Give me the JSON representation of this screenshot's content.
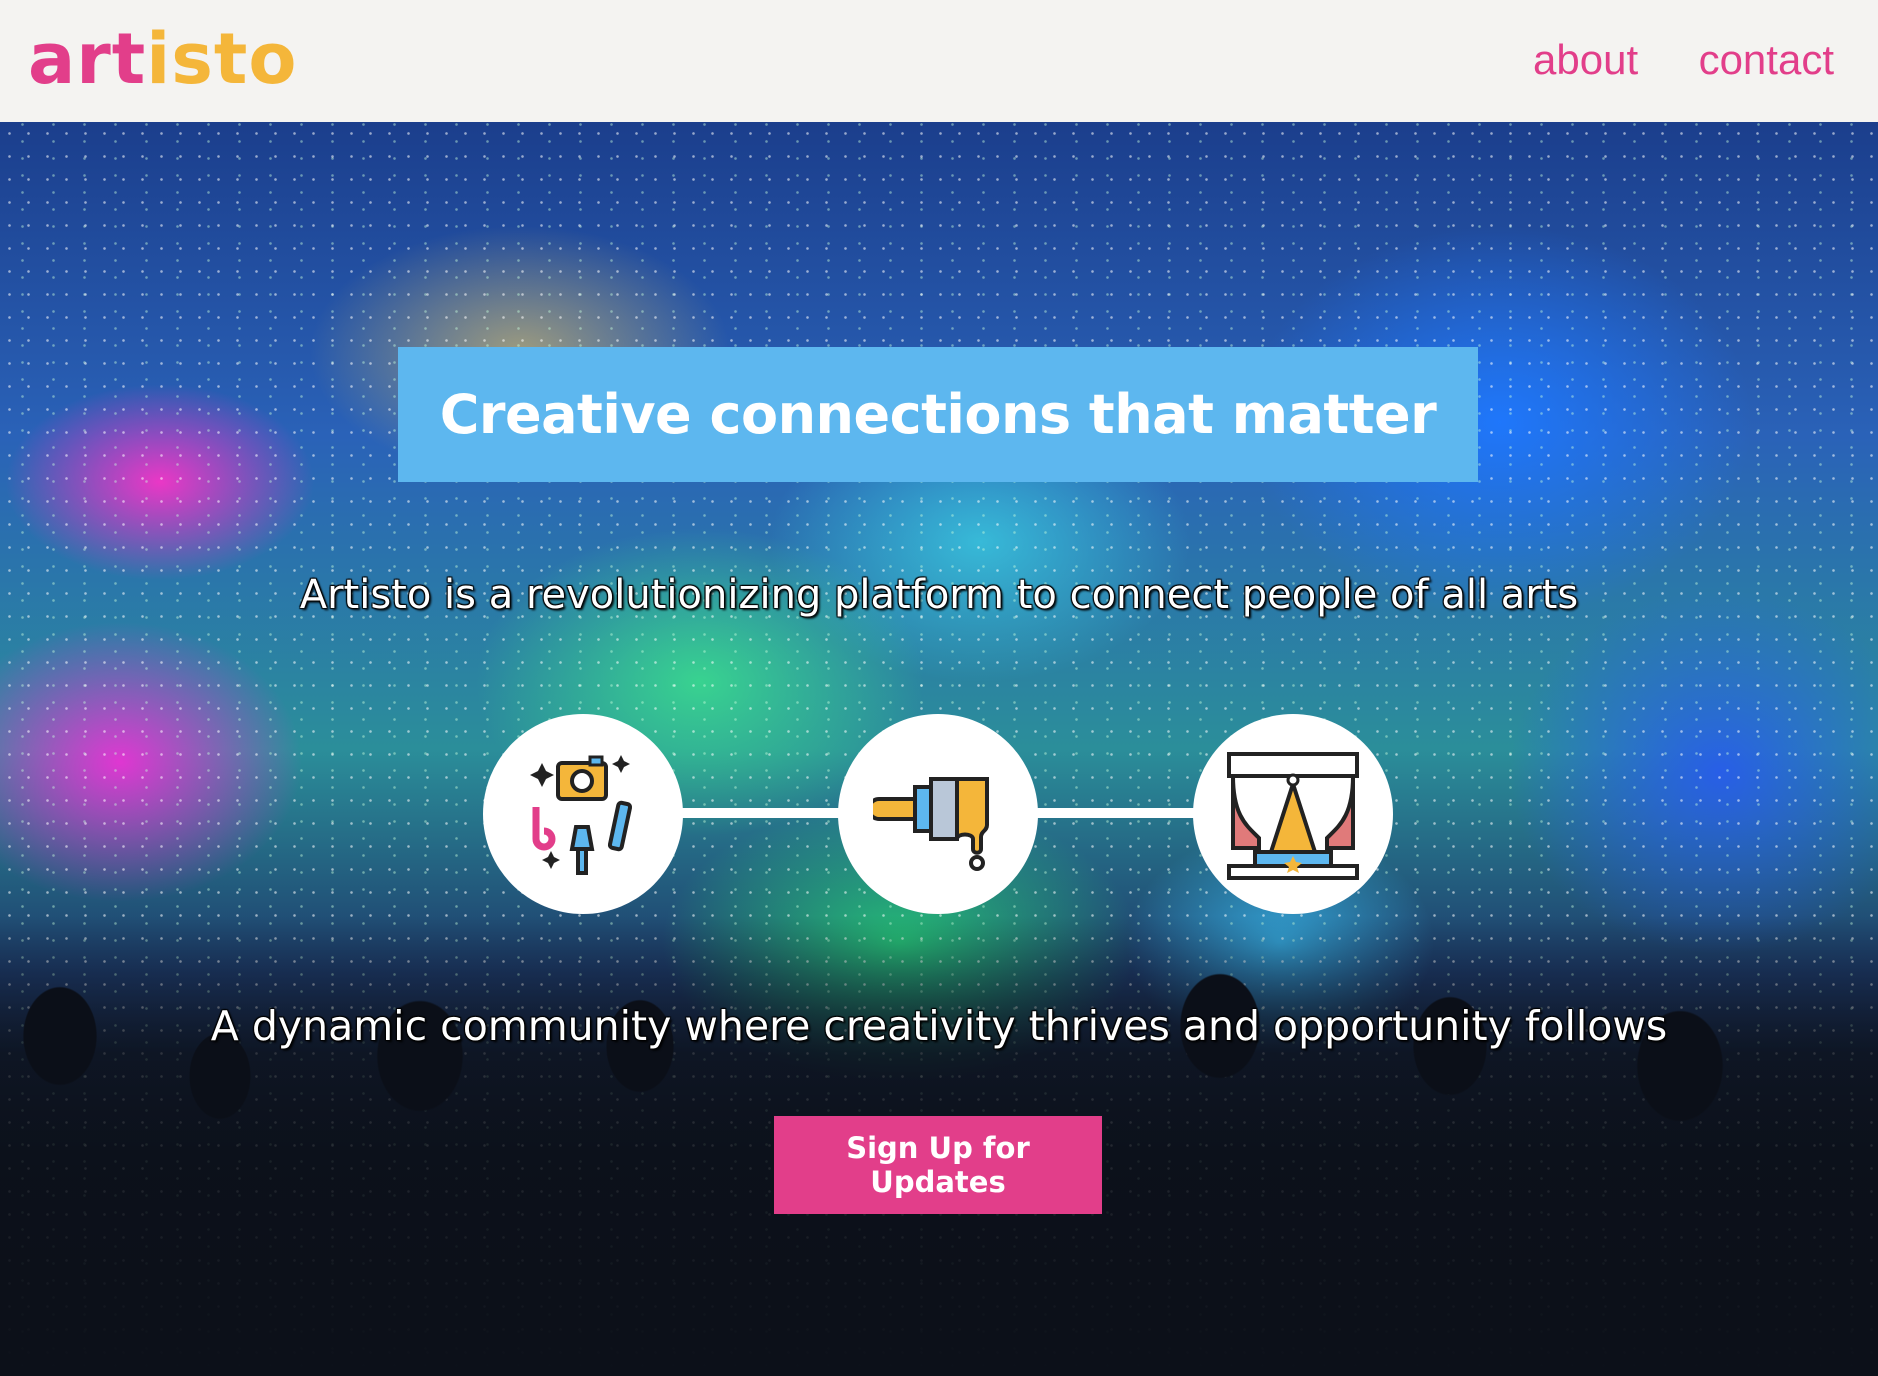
{
  "brand": {
    "name_part_1": "art",
    "name_part_2": "isto",
    "color_primary": "#e23e8a",
    "color_secondary": "#f4b63a"
  },
  "nav": {
    "items": [
      {
        "label": "about"
      },
      {
        "label": "contact"
      }
    ]
  },
  "hero": {
    "headline": "Creative connections that matter",
    "tagline_1": "Artisto is a revolutionizing platform to connect people of all arts",
    "tagline_2": "A dynamic community where creativity thrives and opportunity follows",
    "cta_label": "Sign Up for Updates",
    "headline_bg": "#5db7ef",
    "cta_bg": "#e23e8a",
    "icons": [
      "arts-tools-icon",
      "paint-brush-icon",
      "theater-stage-icon"
    ],
    "background": "concert-crowd-confetti-photo"
  }
}
